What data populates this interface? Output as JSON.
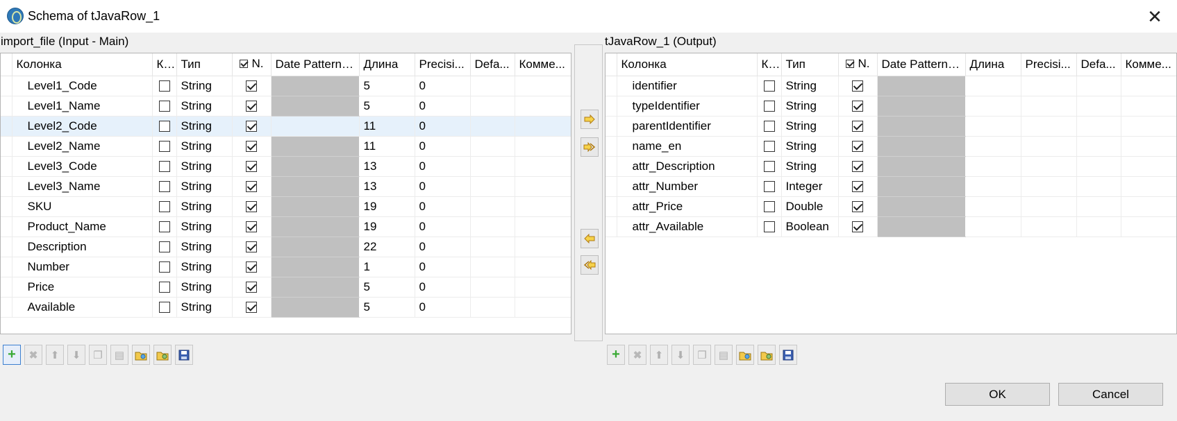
{
  "window": {
    "title": "Schema of tJavaRow_1"
  },
  "input_panel": {
    "label": "import_file (Input - Main)",
    "columns": [
      "Колонка",
      "К...",
      "Тип",
      "N.",
      "Date Pattern ...",
      "Длина",
      "Precisi...",
      "Defa...",
      "Комме..."
    ],
    "rows": [
      {
        "name": "Level1_Code",
        "key": false,
        "type": "String",
        "nullable": true,
        "length": "5",
        "precision": "0"
      },
      {
        "name": "Level1_Name",
        "key": false,
        "type": "String",
        "nullable": true,
        "length": "5",
        "precision": "0"
      },
      {
        "name": "Level2_Code",
        "key": false,
        "type": "String",
        "nullable": true,
        "length": "11",
        "precision": "0"
      },
      {
        "name": "Level2_Name",
        "key": false,
        "type": "String",
        "nullable": true,
        "length": "11",
        "precision": "0"
      },
      {
        "name": "Level3_Code",
        "key": false,
        "type": "String",
        "nullable": true,
        "length": "13",
        "precision": "0"
      },
      {
        "name": "Level3_Name",
        "key": false,
        "type": "String",
        "nullable": true,
        "length": "13",
        "precision": "0"
      },
      {
        "name": "SKU",
        "key": false,
        "type": "String",
        "nullable": true,
        "length": "19",
        "precision": "0"
      },
      {
        "name": "Product_Name",
        "key": false,
        "type": "String",
        "nullable": true,
        "length": "19",
        "precision": "0"
      },
      {
        "name": "Description",
        "key": false,
        "type": "String",
        "nullable": true,
        "length": "22",
        "precision": "0"
      },
      {
        "name": "Number",
        "key": false,
        "type": "String",
        "nullable": true,
        "length": "1",
        "precision": "0"
      },
      {
        "name": "Price",
        "key": false,
        "type": "String",
        "nullable": true,
        "length": "5",
        "precision": "0"
      },
      {
        "name": "Available",
        "key": false,
        "type": "String",
        "nullable": true,
        "length": "5",
        "precision": "0"
      }
    ]
  },
  "output_panel": {
    "label": "tJavaRow_1 (Output)",
    "columns": [
      "Колонка",
      "К...",
      "Тип",
      "N.",
      "Date Pattern ...",
      "Длина",
      "Precisi...",
      "Defa...",
      "Комме..."
    ],
    "rows": [
      {
        "name": "identifier",
        "key": false,
        "type": "String",
        "nullable": true,
        "length": "",
        "precision": ""
      },
      {
        "name": "typeIdentifier",
        "key": false,
        "type": "String",
        "nullable": true,
        "length": "",
        "precision": ""
      },
      {
        "name": "parentIdentifier",
        "key": false,
        "type": "String",
        "nullable": true,
        "length": "",
        "precision": ""
      },
      {
        "name": "name_en",
        "key": false,
        "type": "String",
        "nullable": true,
        "length": "",
        "precision": ""
      },
      {
        "name": "attr_Description",
        "key": false,
        "type": "String",
        "nullable": true,
        "length": "",
        "precision": ""
      },
      {
        "name": "attr_Number",
        "key": false,
        "type": "Integer",
        "nullable": true,
        "length": "",
        "precision": ""
      },
      {
        "name": "attr_Price",
        "key": false,
        "type": "Double",
        "nullable": true,
        "length": "",
        "precision": ""
      },
      {
        "name": "attr_Available",
        "key": false,
        "type": "Boolean",
        "nullable": true,
        "length": "",
        "precision": ""
      }
    ]
  },
  "buttons": {
    "ok": "OK",
    "cancel": "Cancel"
  }
}
